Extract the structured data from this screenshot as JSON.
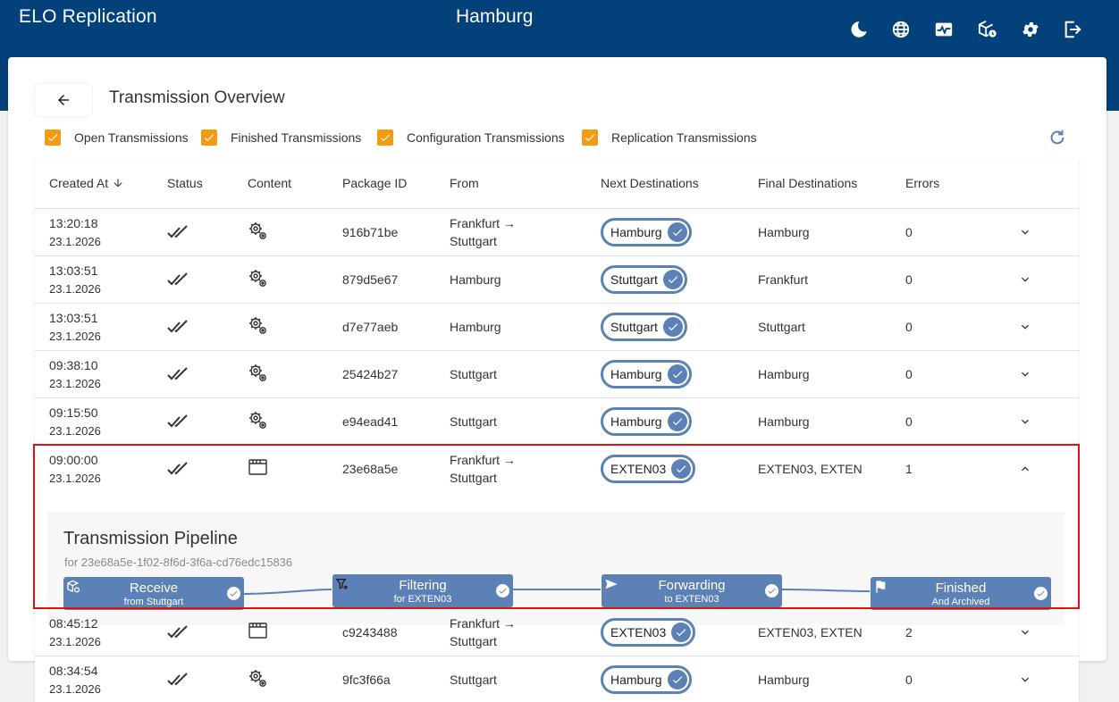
{
  "header": {
    "app_title": "ELO Replication",
    "site_title": "Hamburg",
    "icons": [
      "moon-icon",
      "globe-icon",
      "monitoring-icon",
      "package-history-icon",
      "gear-icon",
      "logout-icon"
    ]
  },
  "page": {
    "title": "Transmission Overview",
    "back_icon": "arrow-left-icon",
    "refresh_icon": "refresh-icon"
  },
  "filters": [
    {
      "label": "Open Transmissions",
      "checked": true
    },
    {
      "label": "Finished Transmissions",
      "checked": true
    },
    {
      "label": "Configuration Transmissions",
      "checked": true
    },
    {
      "label": "Replication Transmissions",
      "checked": true
    }
  ],
  "colors": {
    "header_bg": "#03417a",
    "accent": "#5b81b6",
    "checkbox": "#f39c12",
    "highlight_border": "#e01010"
  },
  "table": {
    "columns": [
      "Created At",
      "Status",
      "Content",
      "Package ID",
      "From",
      "Next Destinations",
      "Final Destinations",
      "Errors"
    ],
    "sort_column": "Created At",
    "sort_direction": "descending",
    "rows": [
      {
        "time": "13:20:18",
        "date": "23.1.2026",
        "status": "done-all-icon",
        "content": "gears-icon",
        "package_id": "916b71be",
        "from": [
          "Frankfurt →",
          "Stuttgart"
        ],
        "next": "Hamburg",
        "final": "Hamburg",
        "errors": "0",
        "expanded": false
      },
      {
        "time": "13:03:51",
        "date": "23.1.2026",
        "status": "done-all-icon",
        "content": "gears-icon",
        "package_id": "879d5e67",
        "from": [
          "Hamburg"
        ],
        "next": "Stuttgart",
        "final": "Frankfurt",
        "errors": "0",
        "expanded": false
      },
      {
        "time": "13:03:51",
        "date": "23.1.2026",
        "status": "done-all-icon",
        "content": "gears-icon",
        "package_id": "d7e77aeb",
        "from": [
          "Hamburg"
        ],
        "next": "Stuttgart",
        "final": "Stuttgart",
        "errors": "0",
        "expanded": false
      },
      {
        "time": "09:38:10",
        "date": "23.1.2026",
        "status": "done-all-icon",
        "content": "gears-icon",
        "package_id": "25424b27",
        "from": [
          "Stuttgart"
        ],
        "next": "Hamburg",
        "final": "Hamburg",
        "errors": "0",
        "expanded": false
      },
      {
        "time": "09:15:50",
        "date": "23.1.2026",
        "status": "done-all-icon",
        "content": "gears-icon",
        "package_id": "e94ead41",
        "from": [
          "Stuttgart"
        ],
        "next": "Hamburg",
        "final": "Hamburg",
        "errors": "0",
        "expanded": false
      },
      {
        "time": "09:00:00",
        "date": "23.1.2026",
        "status": "done-all-icon",
        "content": "window-icon",
        "package_id": "23e68a5e",
        "from": [
          "Frankfurt →",
          "Stuttgart"
        ],
        "next": "EXTEN03",
        "final": "EXTEN03, EXTEN",
        "errors": "1",
        "expanded": true
      },
      {
        "time": "08:45:12",
        "date": "23.1.2026",
        "status": "done-all-icon",
        "content": "window-icon",
        "package_id": "c9243488",
        "from": [
          "Frankfurt →",
          "Stuttgart"
        ],
        "next": "EXTEN03",
        "final": "EXTEN03, EXTEN",
        "errors": "2",
        "expanded": false
      },
      {
        "time": "08:34:54",
        "date": "23.1.2026",
        "status": "done-all-icon",
        "content": "gears-icon",
        "package_id": "9fc3f66a",
        "from": [
          "Stuttgart"
        ],
        "next": "Hamburg",
        "final": "Hamburg",
        "errors": "0",
        "expanded": false
      }
    ]
  },
  "pipeline": {
    "title": "Transmission Pipeline",
    "subtitle": "for 23e68a5e-1f02-8f6d-3f6a-cd76edc15836",
    "stages": [
      {
        "name": "Receive",
        "sub": "from Stuttgart",
        "icon": "package-receive-icon",
        "done": true
      },
      {
        "name": "Filtering",
        "sub": "for EXTEN03",
        "icon": "filter-icon",
        "done": true
      },
      {
        "name": "Forwarding",
        "sub": "to EXTEN03",
        "icon": "send-icon",
        "done": true
      },
      {
        "name": "Finished",
        "sub": "And Archived",
        "icon": "flag-icon",
        "done": true
      }
    ]
  }
}
